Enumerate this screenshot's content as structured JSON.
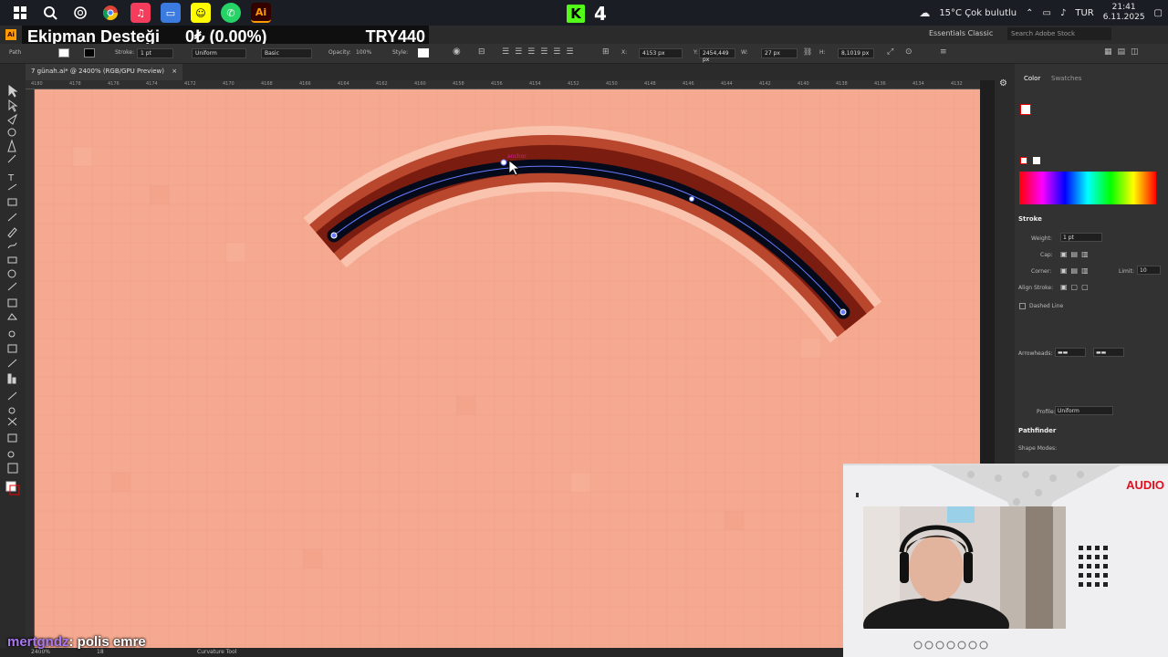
{
  "taskbar": {
    "stream_number": "4",
    "weather": "15°C Çok bulutlu",
    "language": "TUR",
    "time": "21:41",
    "date": "6.11.2025"
  },
  "donation": {
    "label": "Ekipman Desteği",
    "progress": "0₺ (0.00%)",
    "goal": "TRY440"
  },
  "illustrator": {
    "app_badge": "Ai",
    "workspace": "Essentials Classic",
    "search_placeholder": "Search Adobe Stock",
    "control_bar": {
      "path_label": "Path",
      "stroke_label": "Stroke:",
      "stroke_value": "1 pt",
      "profile_value": "Uniform",
      "brush_value": "Basic",
      "opacity_label": "Opacity:",
      "opacity_value": "100%",
      "style_label": "Style:",
      "x_label": "X:",
      "x_value": "4153 px",
      "y_label": "Y:",
      "y_value": "2454,449 px",
      "w_label": "W:",
      "w_value": "27 px",
      "h_label": "H:",
      "h_value": "8,1019 px"
    },
    "document_tab": "7 günah.ai* @ 2400% (RGB/GPU Preview)",
    "ruler_labels": [
      "4180",
      "4178",
      "4176",
      "4174",
      "4172",
      "4170",
      "4168",
      "4166",
      "4164",
      "4162",
      "4160",
      "4158",
      "4156",
      "4154",
      "4152",
      "4150",
      "4148",
      "4146",
      "4144",
      "4142",
      "4140",
      "4138",
      "4136",
      "4134",
      "4132"
    ],
    "anchor_hint": "anchor",
    "status": {
      "zoom": "2400%",
      "page": "18",
      "tool": "Curvature Tool"
    },
    "panels": {
      "color_tab": "Color",
      "swatches_tab": "Swatches",
      "stroke_title": "Stroke",
      "weight_label": "Weight:",
      "weight_value": "1 pt",
      "cap_label": "Cap:",
      "corner_label": "Corner:",
      "limit_label": "Limit:",
      "limit_value": "10",
      "align_label": "Align Stroke:",
      "dashed_label": "Dashed Line",
      "arrowheads_label": "Arrowheads:",
      "profile_label": "Profile:",
      "profile_value": "Uniform",
      "pathfinder_title": "Pathfinder",
      "shape_modes_label": "Shape Modes:"
    }
  },
  "webcam": {
    "overlay_label": "AUDIO"
  },
  "chat": {
    "username": "mertgndz",
    "message": ": polis emre"
  }
}
